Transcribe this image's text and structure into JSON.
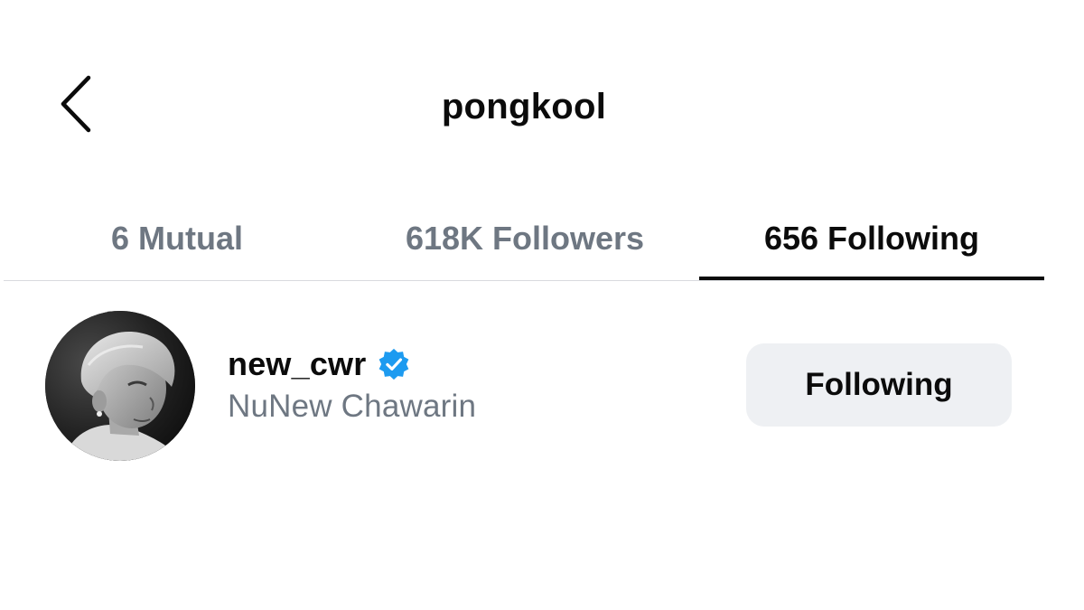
{
  "header": {
    "title": "pongkool",
    "back_icon": "chevron-left-icon"
  },
  "tabs": [
    {
      "label": "6 Mutual",
      "active": false
    },
    {
      "label": "618K Followers",
      "active": false
    },
    {
      "label": "656 Following",
      "active": true
    }
  ],
  "list": {
    "items": [
      {
        "username": "new_cwr",
        "verified": true,
        "full_name": "NuNew Chawarin",
        "button_label": "Following"
      }
    ]
  },
  "colors": {
    "text_primary": "#0b0b0b",
    "text_secondary": "#6e7782",
    "verified_blue": "#1d9bf0",
    "button_bg": "#eef0f3",
    "divider": "#d8dade"
  }
}
